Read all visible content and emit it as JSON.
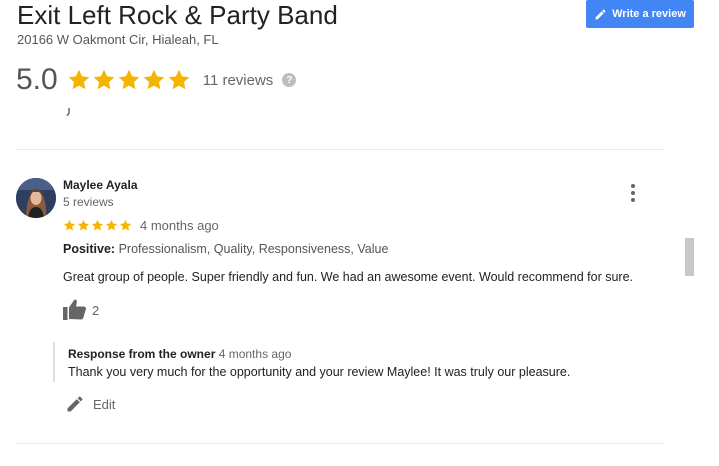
{
  "business": {
    "name": "Exit Left Rock & Party Band",
    "address": "20166 W Oakmont Cir, Hialeah, FL"
  },
  "actions": {
    "write_review_label": "Write a review"
  },
  "rating": {
    "score": "5.0",
    "stars": 5,
    "reviews_label": "11 reviews",
    "help_glyph": "?"
  },
  "review": {
    "reviewer_name": "Maylee Ayala",
    "reviewer_reviews": "5 reviews",
    "stars": 5,
    "time": "4 months ago",
    "positive_label": "Positive:",
    "positive_attributes": "Professionalism, Quality, Responsiveness, Value",
    "text": "Great group of people. Super friendly and fun. We had an awesome event. Would recommend for sure.",
    "likes": "2",
    "response": {
      "title": "Response from the owner",
      "time": "4 months ago",
      "text": "Thank you very much for the opportunity and your review Maylee! It was truly our pleasure."
    },
    "edit_label": "Edit"
  },
  "colors": {
    "star": "#f4b400",
    "button": "#4285f4"
  },
  "icons": {
    "write": "pencil-icon",
    "help": "help-icon",
    "more": "more-vert-icon",
    "like": "thumbs-up-icon",
    "edit": "edit-pencil-icon"
  }
}
